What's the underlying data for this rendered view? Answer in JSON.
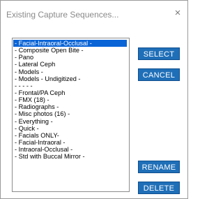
{
  "window": {
    "title": "Existing Capture Sequences...",
    "close_glyph": "×"
  },
  "sequences": {
    "selected_index": 0,
    "items": [
      "- Facial-Intraoral-Occlusal -",
      "- Composite Open Bite -",
      "- Pano",
      "- Lateral Ceph",
      "- Models -",
      "- Models - Undigitized -",
      "- - - - -",
      "- Frontal/PA Ceph",
      "- FMX (18) -",
      "- Radiographs -",
      "- Misc photos (16) -",
      "- Everything -",
      "- Quick -",
      "- Facials ONLY-",
      "- Facial-Intraoral -",
      "- Intraoral-Occlusal -",
      "- Std with Buccal Mirror -"
    ]
  },
  "buttons": {
    "select": "SELECT",
    "cancel": "CANCEL",
    "rename": "RENAME",
    "delete": "DELETE"
  },
  "colors": {
    "selection": "#0a64d6",
    "button": "#1f6fb8"
  }
}
